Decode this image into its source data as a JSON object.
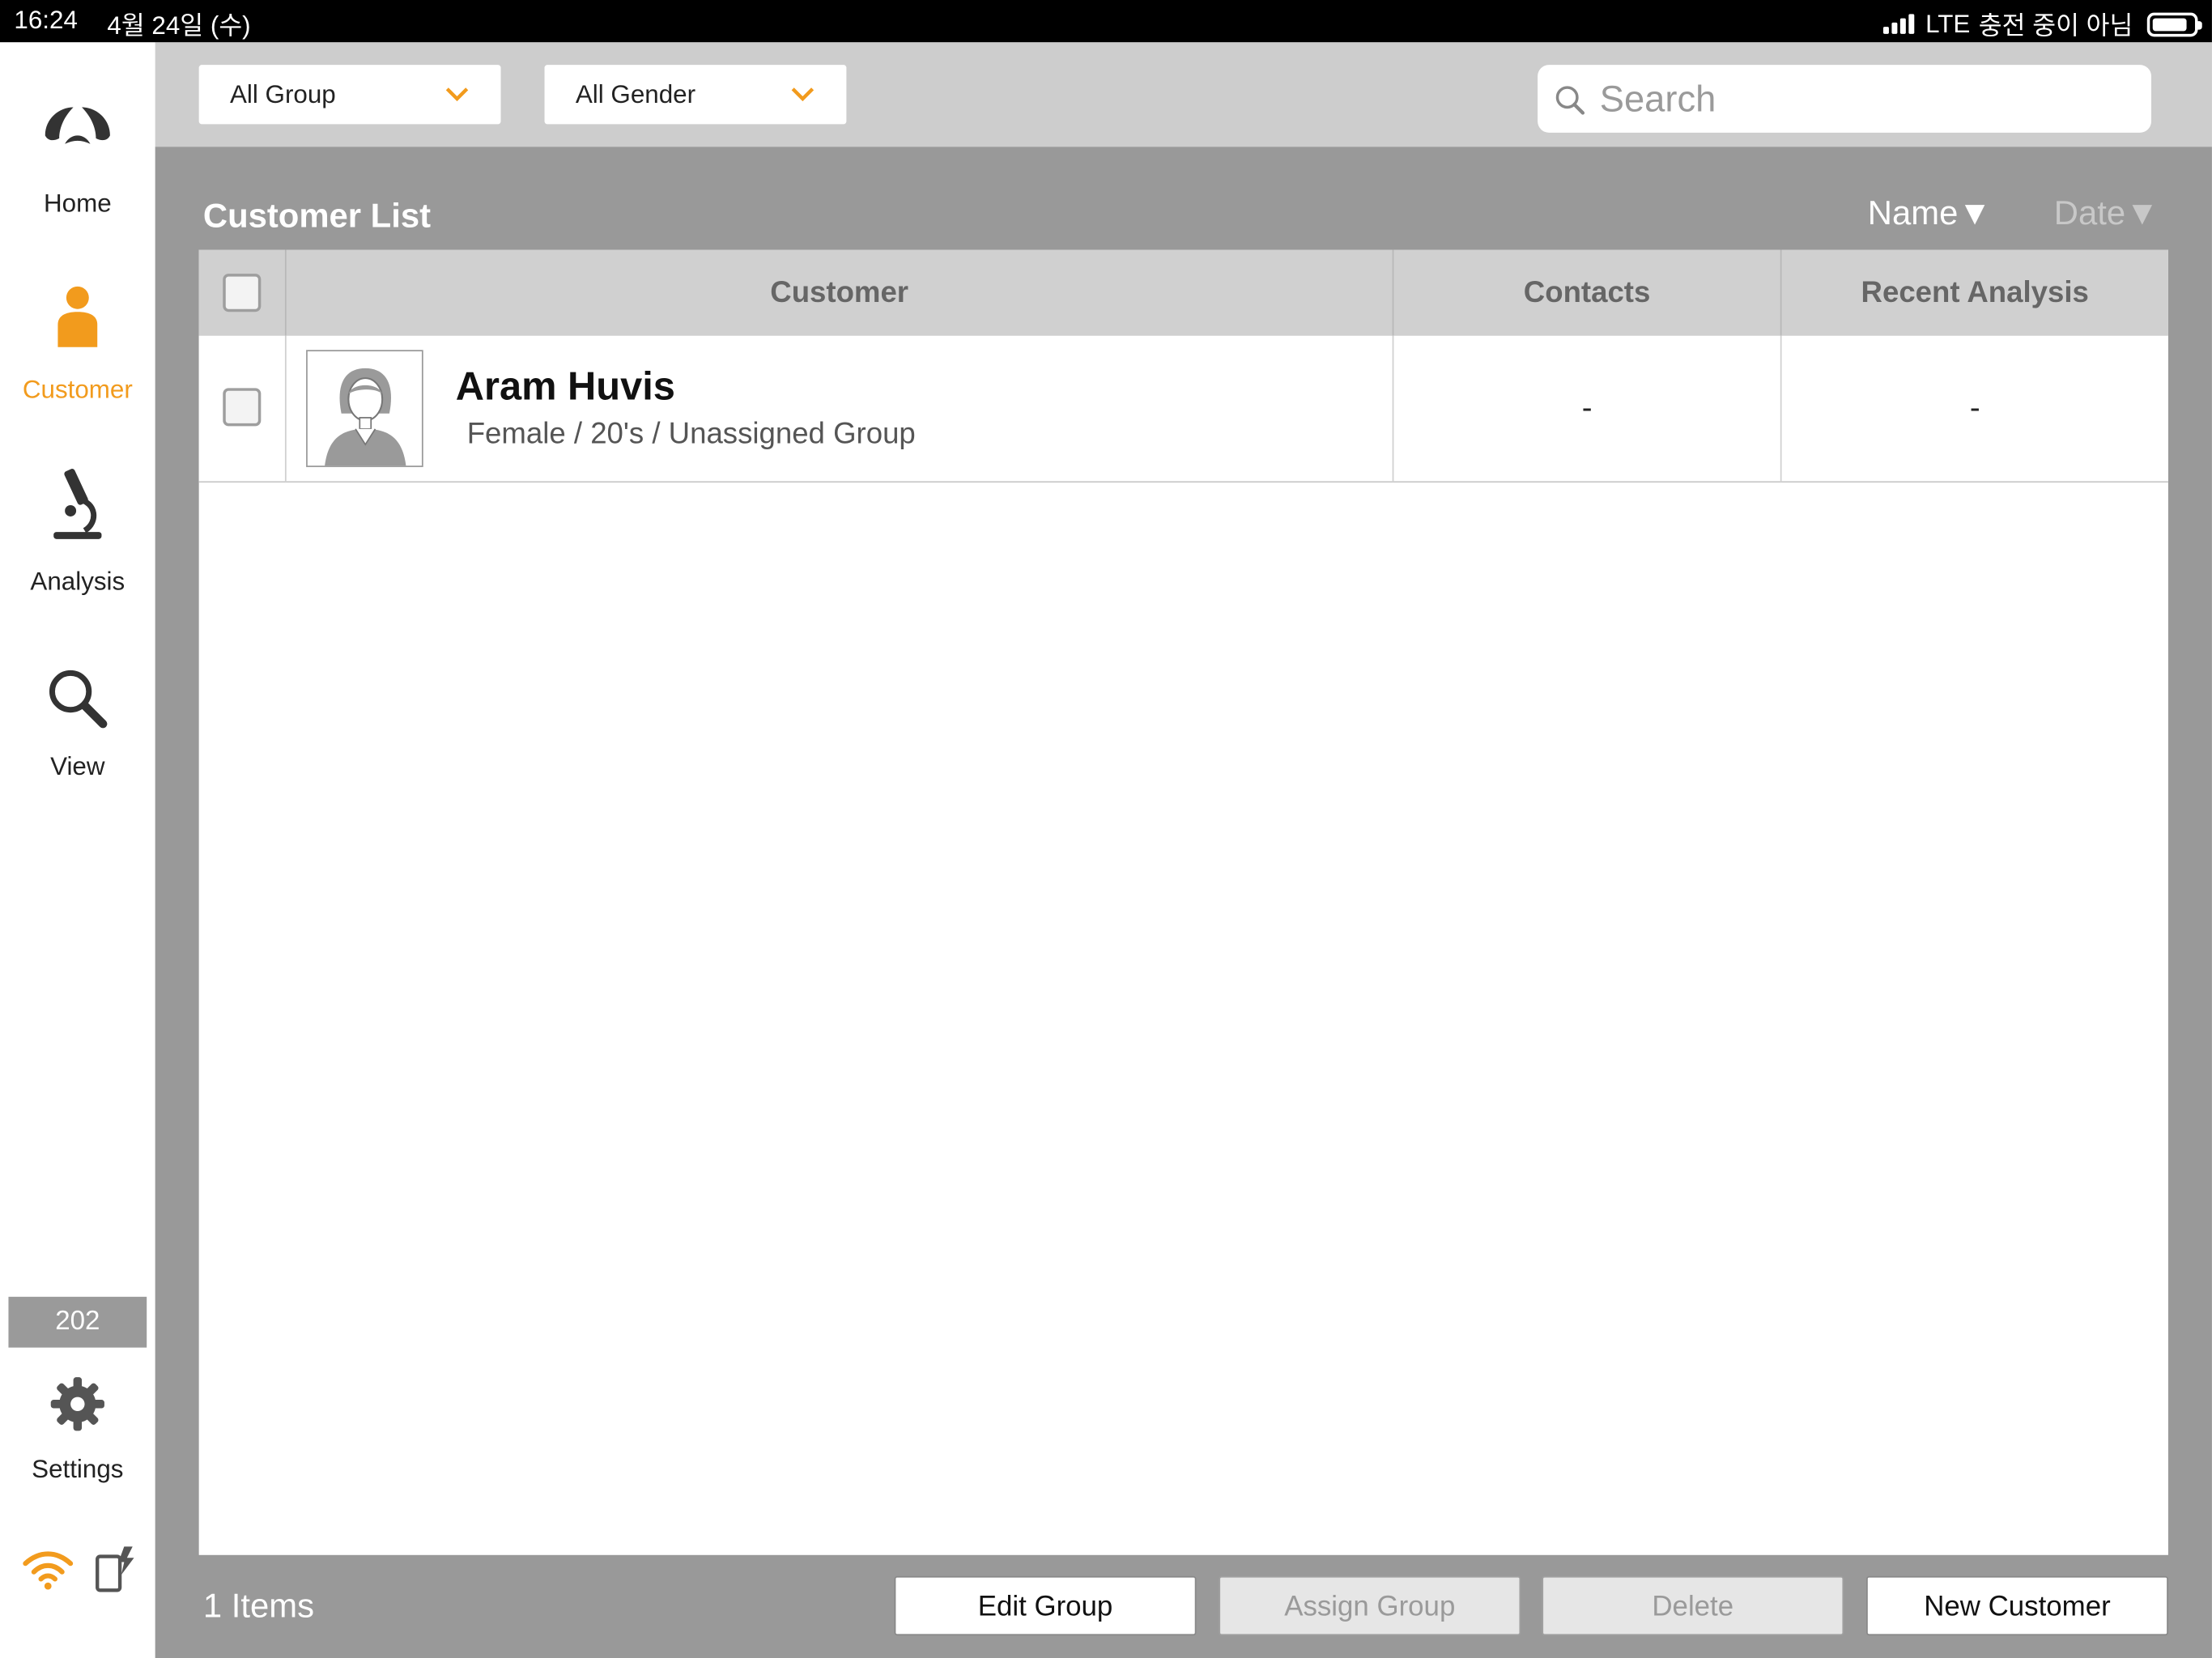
{
  "status_bar": {
    "time": "16:24",
    "date": "4월 24일 (수)",
    "network": "LTE",
    "charging": "충전 중이 아님"
  },
  "sidebar": {
    "items": [
      {
        "label": "Home",
        "icon": "home-logo-icon"
      },
      {
        "label": "Customer",
        "icon": "person-icon",
        "active": true
      },
      {
        "label": "Analysis",
        "icon": "microscope-icon"
      },
      {
        "label": "View",
        "icon": "magnifier-icon"
      }
    ],
    "counter": "202",
    "settings_label": "Settings",
    "bottom_icons": [
      "wifi-icon",
      "device-icon"
    ]
  },
  "filters": {
    "group": "All Group",
    "gender": "All Gender",
    "search_placeholder": "Search"
  },
  "list": {
    "title": "Customer List",
    "sort_name": "Name▼",
    "sort_date": "Date▼",
    "columns": [
      "Customer",
      "Contacts",
      "Recent Analysis"
    ],
    "rows": [
      {
        "name": "Aram Huvis",
        "info": "Female / 20's / Unassigned Group",
        "contacts": "-",
        "recent_analysis": "-"
      }
    ]
  },
  "footer": {
    "items_count": "1 Items",
    "edit_group": "Edit Group",
    "assign_group": "Assign Group",
    "delete": "Delete",
    "new_customer": "New Customer"
  },
  "colors": {
    "accent": "#f29b1d",
    "panel": "#999999",
    "toolbar": "#cdcdcd"
  }
}
